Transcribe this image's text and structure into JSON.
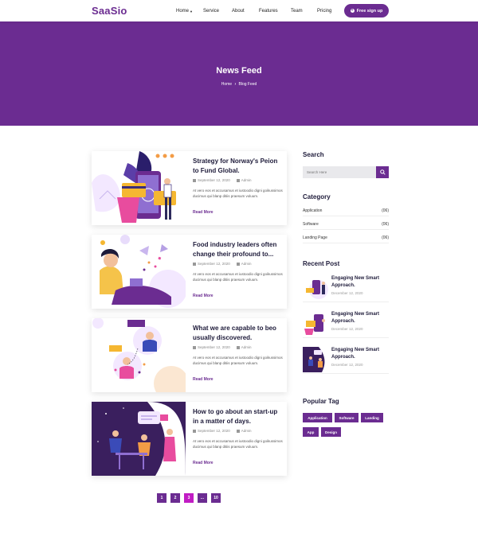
{
  "header": {
    "logo": "SaaSio",
    "nav": [
      "Home",
      "Service",
      "About",
      "Features",
      "Team",
      "Pricing"
    ],
    "signup": "Free sign up"
  },
  "banner": {
    "title": "News Feed",
    "crumb_home": "Home",
    "crumb_current": "Blog Feed"
  },
  "posts": [
    {
      "title": "Strategy for Norway's Peion to Fund Global.",
      "date": "September 12, 2020",
      "author": "Admin",
      "excerpt": "At vero eos et accusamus et iustoodio digni goikussimos ducimus qui blanp ditiis praesum voluum.",
      "more": "Read More"
    },
    {
      "title": "Food industry leaders often change their profound to...",
      "date": "September 12, 2020",
      "author": "Admin",
      "excerpt": "At vero eos et accusamus et iustoodio digni goikussimos ducimus qui blanp ditiis praesum voluum.",
      "more": "Read More"
    },
    {
      "title": "What we are capable to beo usually discovered.",
      "date": "September 12, 2020",
      "author": "Admin",
      "excerpt": "At vero eos et accusamus et iustoodio digni goikussimos ducimus qui blanp ditiis praesum voluum.",
      "more": "Read More"
    },
    {
      "title": "How to go about an start-up in a matter of days.",
      "date": "September 12, 2020",
      "author": "Admin",
      "excerpt": "At vero eos et accusamus et iustoodio digni goikussimos ducimus qui blanp ditiis praesum voluum.",
      "more": "Read More"
    }
  ],
  "pagination": [
    "1",
    "2",
    "3",
    "...",
    "10"
  ],
  "sidebar": {
    "search_title": "Search",
    "search_placeholder": "Search Here",
    "category_title": "Category",
    "categories": [
      {
        "name": "Application",
        "count": "(06)"
      },
      {
        "name": "Software",
        "count": "(06)"
      },
      {
        "name": "Landing Page",
        "count": "(06)"
      }
    ],
    "recent_title": "Recent Post",
    "recent": [
      {
        "title": "Engaging New Smart Approach.",
        "date": "December 12, 2020"
      },
      {
        "title": "Engaging New Smart Approach.",
        "date": "December 12, 2020"
      },
      {
        "title": "Engaging New Smart Approach.",
        "date": "December 12, 2020"
      }
    ],
    "tags_title": "Popular Tag",
    "tags": [
      "Application",
      "Software",
      "Landing",
      "App",
      "Design"
    ]
  },
  "colors": {
    "primary": "#6b2c91",
    "active_page": "#c11cc4"
  }
}
